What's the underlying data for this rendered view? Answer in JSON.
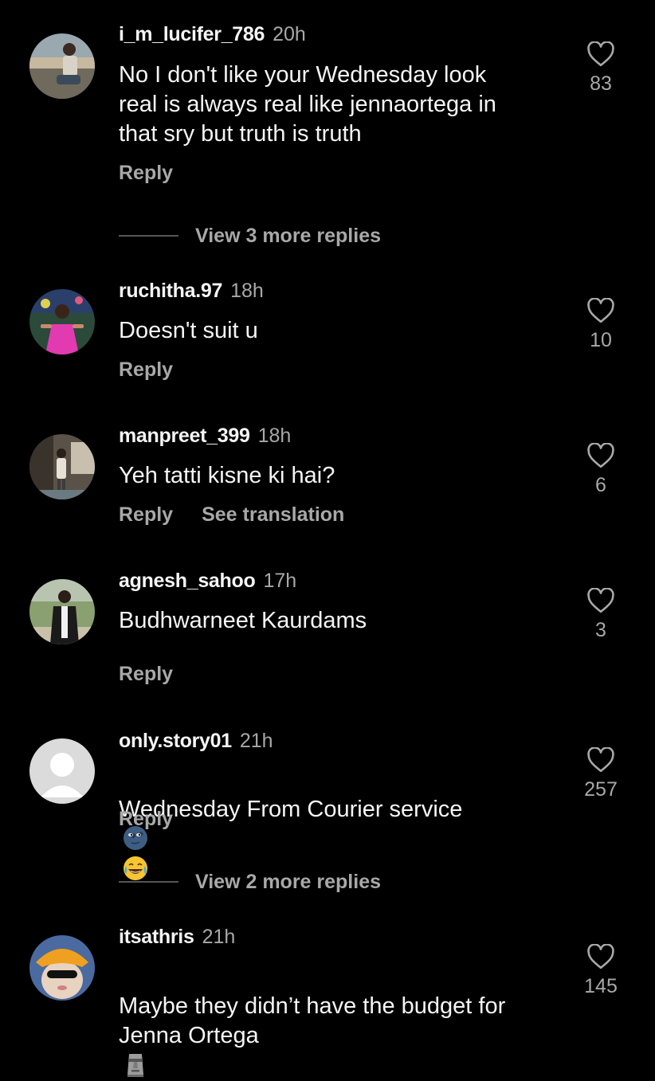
{
  "comments": [
    {
      "username": "i_m_lucifer_786",
      "time": "20h",
      "text": "No I don't like your Wednesday look\nreal is always real like jennaortega in\nthat sry but truth is truth",
      "reply_label": "Reply",
      "likes": "83",
      "avatar": "photo-man-outdoors"
    },
    {
      "username": "ruchitha.97",
      "time": "18h",
      "text": "Doesn't suit u",
      "reply_label": "Reply",
      "likes": "10",
      "avatar": "photo-woman-pink-dress"
    },
    {
      "username": "manpreet_399",
      "time": "18h",
      "text": "Yeh tatti kisne ki hai?",
      "reply_label": "Reply",
      "translation_label": "See translation",
      "likes": "6",
      "avatar": "photo-man-room"
    },
    {
      "username": "agnesh_sahoo",
      "time": "17h",
      "text": "Budhwarneet Kaurdams",
      "reply_label": "Reply",
      "likes": "3",
      "avatar": "photo-man-park"
    },
    {
      "username": "only.story01",
      "time": "21h",
      "text": "Wednesday From Courier service",
      "text_emojis": [
        "new-moon-face-emoji",
        "tears-of-joy-emoji"
      ],
      "reply_label": "Reply",
      "likes": "257",
      "avatar": "default-avatar"
    },
    {
      "username": "itsathris",
      "time": "21h",
      "text": "Maybe they didn’t have the budget for\nJenna Ortega",
      "text_emojis": [
        "moai-emoji"
      ],
      "likes": "145",
      "avatar": "photo-cat-hat"
    }
  ],
  "view_replies": [
    {
      "label": "View 3 more replies"
    },
    {
      "label": "View 2 more replies"
    }
  ],
  "colors": {
    "background": "#000000",
    "primary_text": "#f5f5f5",
    "secondary_text": "#a8a8a8"
  }
}
